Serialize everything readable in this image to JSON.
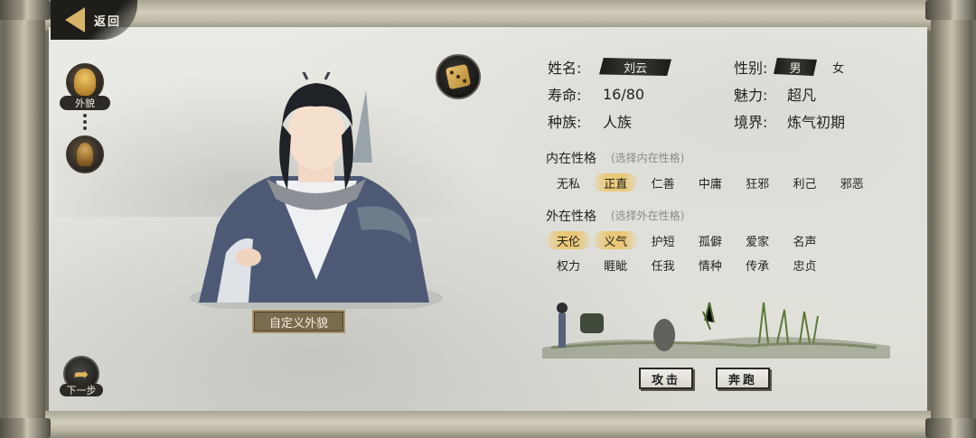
{
  "nav": {
    "back_label": "返回"
  },
  "side": {
    "appearance_label": "外貌",
    "next_label": "下一步"
  },
  "portrait": {
    "customize_label": "自定义外貌"
  },
  "profile": {
    "name_label": "姓名:",
    "name_value": "刘云",
    "gender_label": "性别:",
    "gender_selected": "男",
    "gender_other": "女",
    "lifespan_label": "寿命:",
    "lifespan_value": "16/80",
    "charm_label": "魅力:",
    "charm_value": "超凡",
    "race_label": "种族:",
    "race_value": "人族",
    "realm_label": "境界:",
    "realm_value": "炼气初期"
  },
  "inner": {
    "title": "内在性格",
    "hint": "(选择内在性格)",
    "traits": [
      {
        "label": "无私",
        "selected": false
      },
      {
        "label": "正直",
        "selected": true
      },
      {
        "label": "仁善",
        "selected": false
      },
      {
        "label": "中庸",
        "selected": false
      },
      {
        "label": "狂邪",
        "selected": false
      },
      {
        "label": "利己",
        "selected": false
      },
      {
        "label": "邪恶",
        "selected": false
      }
    ]
  },
  "outer": {
    "title": "外在性格",
    "hint": "(选择外在性格)",
    "traits": [
      {
        "label": "天伦",
        "selected": true
      },
      {
        "label": "义气",
        "selected": true
      },
      {
        "label": "护短",
        "selected": false
      },
      {
        "label": "孤僻",
        "selected": false
      },
      {
        "label": "爱家",
        "selected": false
      },
      {
        "label": "名声",
        "selected": false
      },
      {
        "label": "权力",
        "selected": false
      },
      {
        "label": "睚眦",
        "selected": false
      },
      {
        "label": "任我",
        "selected": false
      },
      {
        "label": "情种",
        "selected": false
      },
      {
        "label": "传承",
        "selected": false
      },
      {
        "label": "忠贞",
        "selected": false
      }
    ]
  },
  "actions": {
    "attack_label": "攻击",
    "flee_label": "奔跑"
  },
  "colors": {
    "accent_gold": "#e9c877",
    "ink": "#1b1b19",
    "paper": "#e8e8e2"
  }
}
